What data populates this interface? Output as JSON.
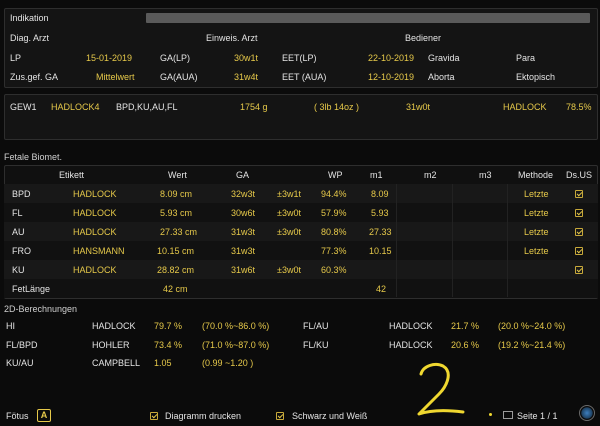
{
  "header": {
    "indikation_label": "Indikation",
    "diag_arzt_label": "Diag. Arzt",
    "einweis_arzt_label": "Einweis. Arzt",
    "bediener_label": "Bediener",
    "lp_label": "LP",
    "lp_value": "15-01-2019",
    "ga_lp_label": "GA(LP)",
    "ga_lp_value": "30w1t",
    "eet_lp_label": "EET(LP)",
    "eet_lp_value": "22-10-2019",
    "gravida_label": "Gravida",
    "para_label": "Para",
    "zus_ga_label": "Zus.gef. GA",
    "zus_ga_value": "Mittelwert",
    "ga_aua_label": "GA(AUA)",
    "ga_aua_value": "31w4t",
    "eet_aua_label": "EET (AUA)",
    "eet_aua_value": "12-10-2019",
    "aborta_label": "Aborta",
    "ektopisch_label": "Ektopisch"
  },
  "gew": {
    "label": "GEW1",
    "method": "HADLOCK4",
    "params": "BPD,KU,AU,FL",
    "weight": "1754 g",
    "weight_lb": "( 3lb 14oz )",
    "ga": "31w0t",
    "pct_method": "HADLOCK",
    "pct": "78.5%"
  },
  "biomet": {
    "title": "Fetale Biomet.",
    "columns": [
      "Etikett",
      "Wert",
      "GA",
      "WP",
      "m1",
      "m2",
      "m3",
      "Methode",
      "Ds.US"
    ],
    "rows": [
      {
        "name": "BPD",
        "etikett": "HADLOCK",
        "wert": "8.09 cm",
        "ga": "32w3t",
        "sd": "±3w1t",
        "wp": "94.4%",
        "m1": "8.09",
        "methode": "Letzte",
        "ds": true
      },
      {
        "name": "FL",
        "etikett": "HADLOCK",
        "wert": "5.93 cm",
        "ga": "30w6t",
        "sd": "±3w0t",
        "wp": "57.9%",
        "m1": "5.93",
        "methode": "Letzte",
        "ds": true
      },
      {
        "name": "AU",
        "etikett": "HADLOCK",
        "wert": "27.33 cm",
        "ga": "31w3t",
        "sd": "±3w0t",
        "wp": "80.8%",
        "m1": "27.33",
        "methode": "Letzte",
        "ds": true
      },
      {
        "name": "FRO",
        "etikett": "HANSMANN",
        "wert": "10.15 cm",
        "ga": "31w3t",
        "sd": "",
        "wp": "77.3%",
        "m1": "10.15",
        "methode": "Letzte",
        "ds": true
      },
      {
        "name": "KU",
        "etikett": "HADLOCK",
        "wert": "28.82 cm",
        "ga": "31w6t",
        "sd": "±3w0t",
        "wp": "60.3%",
        "m1": "",
        "methode": "",
        "ds": true
      }
    ],
    "fet_laenge_label": "FetLänge",
    "fet_laenge_value": "42 cm",
    "fet_laenge_m1": "42"
  },
  "calc2d": {
    "title": "2D-Berechnungen",
    "left": [
      {
        "name": "HI",
        "method": "HADLOCK",
        "value": "79.7 %",
        "range": "(70.0 %~86.0 %)"
      },
      {
        "name": "FL/BPD",
        "method": "HOHLER",
        "value": "73.4 %",
        "range": "(71.0 %~87.0 %)"
      },
      {
        "name": "KU/AU",
        "method": "CAMPBELL",
        "value": "1.05",
        "range": "(0.99 ~1.20 )"
      }
    ],
    "right": [
      {
        "name": "FL/AU",
        "method": "HADLOCK",
        "value": "21.7 %",
        "range": "(20.0 %~24.0 %)"
      },
      {
        "name": "FL/KU",
        "method": "HADLOCK",
        "value": "20.6 %",
        "range": "(19.2 %~21.4 %)"
      }
    ]
  },
  "footer": {
    "fetus_label": "Fötus",
    "fetus_badge": "A",
    "diagramm_label": "Diagramm drucken",
    "schwarz_label": "Schwarz und Weiß",
    "page_label": "Seite 1 / 1",
    "annotation": "2"
  }
}
